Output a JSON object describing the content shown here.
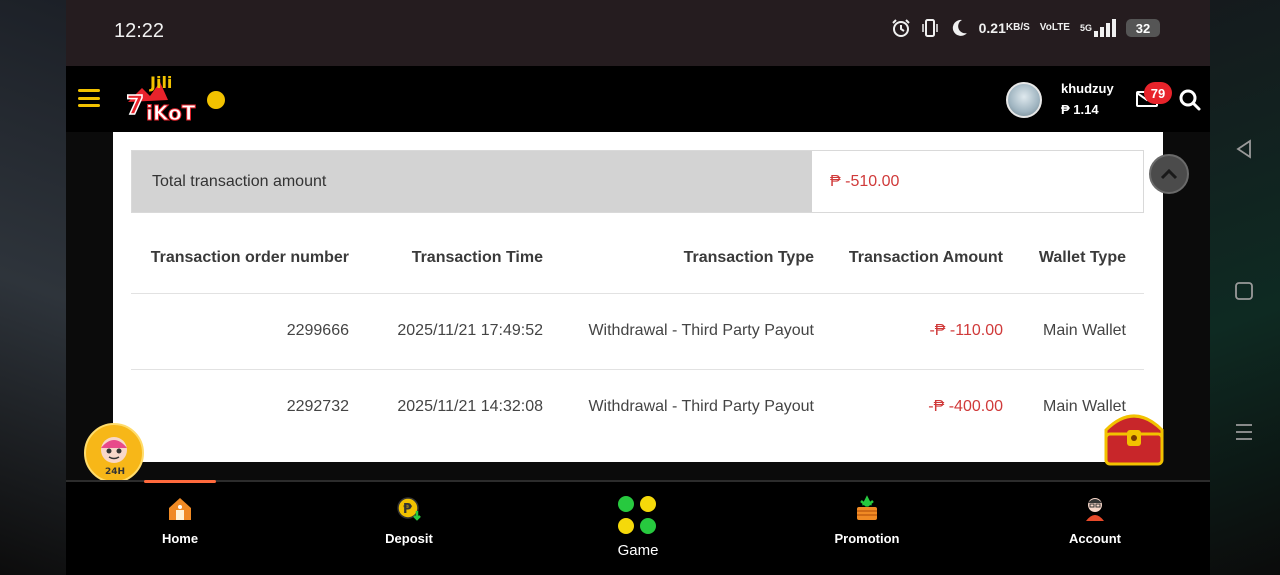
{
  "status_bar": {
    "time": "12:22",
    "net_speed": "0.21",
    "net_unit": "KB/S",
    "volte_top": "Vo",
    "volte_bottom": "LTE",
    "signal_label": "5G",
    "battery": "32"
  },
  "header": {
    "username": "khudzuy",
    "balance": "₱ 1.14",
    "mail_count": "79"
  },
  "summary": {
    "label": "Total transaction amount",
    "value": "₱ -510.00"
  },
  "table": {
    "columns": [
      "Transaction order number",
      "Transaction Time",
      "Transaction Type",
      "Transaction Amount",
      "Wallet Type"
    ],
    "rows": [
      {
        "order": "2299666",
        "time": "2025/11/21 17:49:52",
        "type": "Withdrawal - Third Party Payout",
        "amount": "-₱ -110.00",
        "wallet": "Main Wallet"
      },
      {
        "order": "2292732",
        "time": "2025/11/21 14:32:08",
        "type": "Withdrawal - Third Party Payout",
        "amount": "-₱ -400.00",
        "wallet": "Main Wallet"
      }
    ]
  },
  "bottom_nav": {
    "home": "Home",
    "deposit": "Deposit",
    "game": "Game",
    "promotion": "Promotion",
    "account": "Account"
  },
  "support_badge": "24H",
  "colors": {
    "accent": "#f2c200",
    "negative": "#d03a3a",
    "badge": "#e8232b",
    "game_dot_green": "#27c93f",
    "game_dot_yellow": "#f5d90a"
  }
}
